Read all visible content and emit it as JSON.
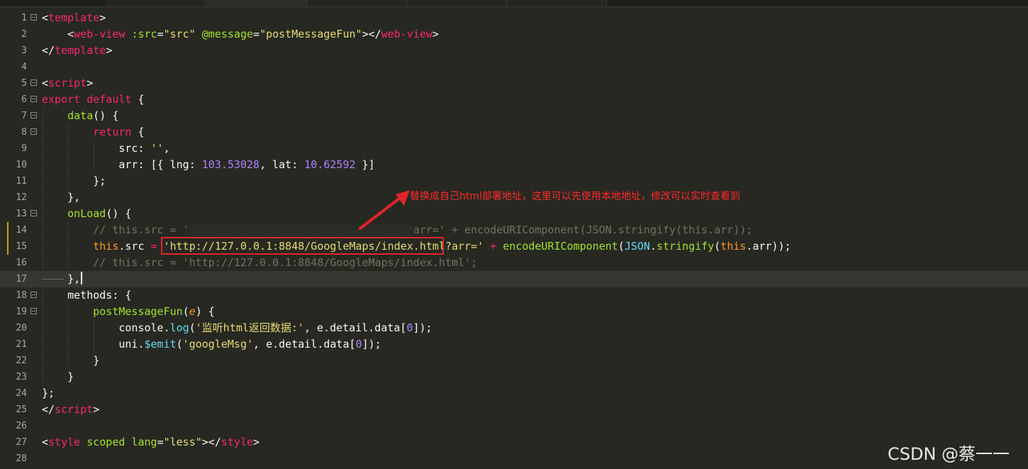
{
  "editor": {
    "highlight_color": "#e0262b",
    "lines": [
      {
        "n": "1",
        "tokens": [
          [
            "t-punc",
            "<"
          ],
          [
            "t-tag",
            "template"
          ],
          [
            "t-punc",
            ">"
          ]
        ]
      },
      {
        "n": "2",
        "tokens": [
          [
            "t-plain",
            "    "
          ],
          [
            "t-punc",
            "<"
          ],
          [
            "t-tag",
            "web-view"
          ],
          [
            "t-plain",
            " "
          ],
          [
            "t-attr",
            ":src"
          ],
          [
            "t-punc",
            "="
          ],
          [
            "t-str",
            "\"src\""
          ],
          [
            "t-plain",
            " "
          ],
          [
            "t-attr",
            "@message"
          ],
          [
            "t-punc",
            "="
          ],
          [
            "t-str",
            "\"postMessageFun\""
          ],
          [
            "t-punc",
            "></"
          ],
          [
            "t-tag",
            "web-view"
          ],
          [
            "t-punc",
            ">"
          ]
        ]
      },
      {
        "n": "3",
        "tokens": [
          [
            "t-punc",
            "</"
          ],
          [
            "t-tag",
            "template"
          ],
          [
            "t-punc",
            ">"
          ]
        ]
      },
      {
        "n": "4",
        "tokens": []
      },
      {
        "n": "5",
        "tokens": [
          [
            "t-punc",
            "<"
          ],
          [
            "t-tag",
            "script"
          ],
          [
            "t-punc",
            ">"
          ]
        ]
      },
      {
        "n": "6",
        "tokens": [
          [
            "t-kw",
            "export default"
          ],
          [
            "t-plain",
            " {"
          ]
        ]
      },
      {
        "n": "7",
        "tokens": [
          [
            "t-plain",
            "    "
          ],
          [
            "t-fn",
            "data"
          ],
          [
            "t-plain",
            "() {"
          ]
        ]
      },
      {
        "n": "8",
        "tokens": [
          [
            "t-plain",
            "        "
          ],
          [
            "t-kw",
            "return"
          ],
          [
            "t-plain",
            " {"
          ]
        ]
      },
      {
        "n": "9",
        "tokens": [
          [
            "t-plain",
            "            src: "
          ],
          [
            "t-str",
            "''"
          ],
          [
            "t-plain",
            ","
          ]
        ]
      },
      {
        "n": "10",
        "tokens": [
          [
            "t-plain",
            "            arr: [{ lng: "
          ],
          [
            "t-num",
            "103.53028"
          ],
          [
            "t-plain",
            ", lat: "
          ],
          [
            "t-num",
            "10.62592"
          ],
          [
            "t-plain",
            " }]"
          ]
        ]
      },
      {
        "n": "11",
        "tokens": [
          [
            "t-plain",
            "        };"
          ]
        ]
      },
      {
        "n": "12",
        "tokens": [
          [
            "t-plain",
            "    },"
          ]
        ]
      },
      {
        "n": "13",
        "tokens": [
          [
            "t-plain",
            "    "
          ],
          [
            "t-fn",
            "onLoad"
          ],
          [
            "t-plain",
            "() {"
          ]
        ]
      },
      {
        "n": "14",
        "tokens": [
          [
            "t-plain",
            "        "
          ],
          [
            "t-cm",
            "// this.src = '                                  ?arr=' + encodeURIComponent(JSON.stringify(this.arr));"
          ]
        ]
      },
      {
        "n": "15",
        "tokens": [
          [
            "t-plain",
            "        "
          ],
          [
            "t-this",
            "this"
          ],
          [
            "t-plain",
            ".src "
          ],
          [
            "t-pink",
            "="
          ],
          [
            "t-plain",
            " "
          ],
          [
            "t-str",
            "'http://127.0.0.1:8848/GoogleMaps/index.html?arr='"
          ],
          [
            "t-plain",
            " "
          ],
          [
            "t-pink",
            "+"
          ],
          [
            "t-plain",
            " "
          ],
          [
            "t-fn",
            "encodeURIComponent"
          ],
          [
            "t-plain",
            "("
          ],
          [
            "t-type",
            "JSON"
          ],
          [
            "t-plain",
            "."
          ],
          [
            "t-fn",
            "stringify"
          ],
          [
            "t-plain",
            "("
          ],
          [
            "t-this",
            "this"
          ],
          [
            "t-plain",
            ".arr));"
          ]
        ]
      },
      {
        "n": "16",
        "tokens": [
          [
            "t-plain",
            "        "
          ],
          [
            "t-cm",
            "// this.src = 'http://127.0.0.1:8848/GoogleMaps/index.html';"
          ]
        ]
      },
      {
        "n": "17",
        "tokens": [
          [
            "t-plain",
            "    },"
          ]
        ]
      },
      {
        "n": "18",
        "tokens": [
          [
            "t-plain",
            "    methods: {"
          ]
        ]
      },
      {
        "n": "19",
        "tokens": [
          [
            "t-plain",
            "        "
          ],
          [
            "t-fn",
            "postMessageFun"
          ],
          [
            "t-plain",
            "("
          ],
          [
            "t-param",
            "e"
          ],
          [
            "t-plain",
            ") {"
          ]
        ]
      },
      {
        "n": "20",
        "tokens": [
          [
            "t-plain",
            "            console."
          ],
          [
            "t-type",
            "log"
          ],
          [
            "t-plain",
            "("
          ],
          [
            "t-str",
            "'监听html返回数据:'"
          ],
          [
            "t-plain",
            ", e.detail.data["
          ],
          [
            "t-num",
            "0"
          ],
          [
            "t-plain",
            "]);"
          ]
        ]
      },
      {
        "n": "21",
        "tokens": [
          [
            "t-plain",
            "            uni."
          ],
          [
            "t-type",
            "$emit"
          ],
          [
            "t-plain",
            "("
          ],
          [
            "t-str",
            "'googleMsg'"
          ],
          [
            "t-plain",
            ", e.detail.data["
          ],
          [
            "t-num",
            "0"
          ],
          [
            "t-plain",
            "]);"
          ]
        ]
      },
      {
        "n": "22",
        "tokens": [
          [
            "t-plain",
            "        }"
          ]
        ]
      },
      {
        "n": "23",
        "tokens": [
          [
            "t-plain",
            "    }"
          ]
        ]
      },
      {
        "n": "24",
        "tokens": [
          [
            "t-plain",
            "};"
          ]
        ]
      },
      {
        "n": "25",
        "tokens": [
          [
            "t-punc",
            "</"
          ],
          [
            "t-tag",
            "script"
          ],
          [
            "t-punc",
            ">"
          ]
        ]
      },
      {
        "n": "26",
        "tokens": []
      },
      {
        "n": "27",
        "tokens": [
          [
            "t-punc",
            "<"
          ],
          [
            "t-tag",
            "style"
          ],
          [
            "t-plain",
            " "
          ],
          [
            "t-attr",
            "scoped"
          ],
          [
            "t-plain",
            " "
          ],
          [
            "t-attr",
            "lang"
          ],
          [
            "t-punc",
            "="
          ],
          [
            "t-str",
            "\"less\""
          ],
          [
            "t-punc",
            "></"
          ],
          [
            "t-tag",
            "style"
          ],
          [
            "t-punc",
            ">"
          ]
        ]
      },
      {
        "n": "28",
        "tokens": []
      }
    ]
  },
  "annotation": {
    "text": "替换成自己html部署地址，这里可以先使用本地地址，修改可以实时查看到",
    "color": "#ff2a2a"
  },
  "watermark": "CSDN @蔡一一"
}
